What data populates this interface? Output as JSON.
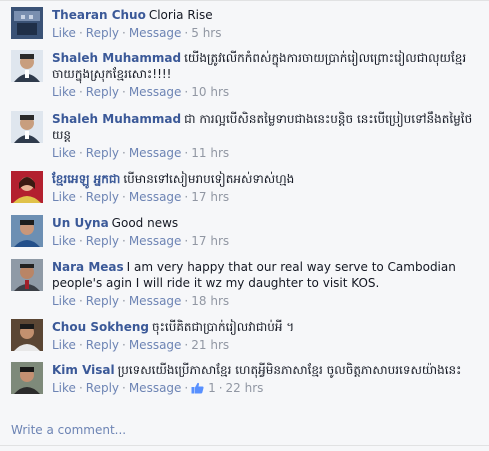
{
  "actions": {
    "like": "Like",
    "reply": "Reply",
    "message": "Message",
    "dot": "·"
  },
  "colors": {
    "link": "#3b5998",
    "action": "#6d84b4",
    "meta": "#9197a3",
    "background": "#f6f7f9"
  },
  "comments": [
    {
      "author": "Thearan Chuo",
      "text": "Cloria Rise",
      "time": "5 hrs"
    },
    {
      "author": "Shaleh Muhammad",
      "text": "យើងត្រូវលើកកំពស់ក្នុងការចាយប្រាក់រៀលព្រោះរៀលជាលុយខ្មែរ ចាយក្នុងស្រុកខ្មែរសោះ!!!!",
      "time": "10 hrs"
    },
    {
      "author": "Shaleh Muhammad",
      "text": "ជា ការល្អបើសិនតម្លៃទាបជាងនេះបន្តិច នេះបើប្រៀបទៅនឹងតម្លៃថៃយន្ត",
      "time": "11 hrs"
    },
    {
      "author": "ខ្មែរអេឡូ អ្នកជា",
      "text": "បើមានទៅសៀមរាបទៀតអស់ទាស់ហ្មង",
      "time": "17 hrs"
    },
    {
      "author": "Un Uyna",
      "text": "Good news",
      "time": "17 hrs"
    },
    {
      "author": "Nara Meas",
      "text": "I am very happy that our real way serve to Cambodian people's agin I will ride it wz my daughter to visit KOS.",
      "time": "18 hrs"
    },
    {
      "author": "Chou Sokheng",
      "text": "ចុះបើគិតជាប្រាក់រៀលវាជាប់អី ។",
      "time": "21 hrs"
    },
    {
      "author": "Kim Visal",
      "text": "ប្រទេសយើងប្រើភាសាខ្មែរ ហេតុអ្វីមិនភាសាខ្មែរ ចូលចិត្តភាសាបរទេសយ៉ាងនេះ",
      "time": "22 hrs",
      "like_count": "1"
    }
  ],
  "write_comment": "Write a comment..."
}
